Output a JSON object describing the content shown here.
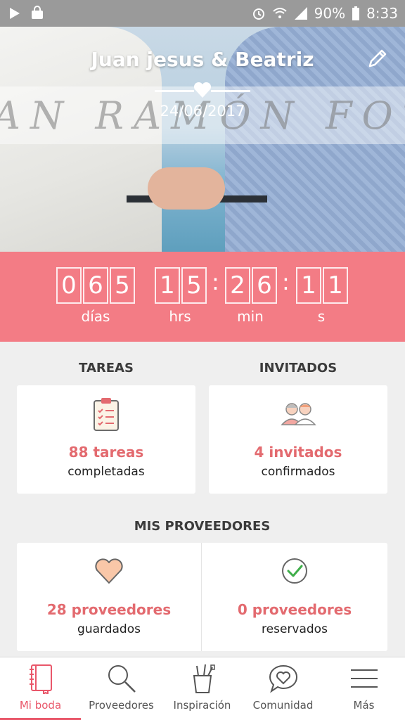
{
  "status_bar": {
    "battery": "90%",
    "time": "8:33"
  },
  "hero": {
    "couple": "Juan jesus & Beatriz",
    "date": "24/06/2017",
    "watermark": "AN RAMÓN FOTÓGI"
  },
  "countdown": {
    "days_digits": [
      "0",
      "6",
      "5"
    ],
    "hours_digits": [
      "1",
      "5"
    ],
    "minutes_digits": [
      "2",
      "6"
    ],
    "seconds_digits": [
      "1",
      "1"
    ],
    "separator": ":",
    "labels": {
      "days": "días",
      "hours": "hrs",
      "minutes": "min",
      "seconds": "s"
    }
  },
  "tasks": {
    "heading": "TAREAS",
    "count": "88 tareas",
    "sub": "completadas"
  },
  "guests": {
    "heading": "INVITADOS",
    "count": "4 invitados",
    "sub": "confirmados"
  },
  "providers": {
    "heading": "MIS PROVEEDORES",
    "saved": {
      "count": "28 proveedores",
      "sub": "guardados"
    },
    "booked": {
      "count": "0 proveedores",
      "sub": "reservados"
    }
  },
  "nav": {
    "items": [
      {
        "label": "Mi boda",
        "icon": "notebook-icon"
      },
      {
        "label": "Proveedores",
        "icon": "search-icon"
      },
      {
        "label": "Inspiración",
        "icon": "pencil-cup-icon"
      },
      {
        "label": "Comunidad",
        "icon": "chat-heart-icon"
      },
      {
        "label": "Más",
        "icon": "menu-icon"
      }
    ]
  },
  "colors": {
    "accent": "#f37c85",
    "count_text": "#e36a6f",
    "active_nav": "#e9576a"
  }
}
